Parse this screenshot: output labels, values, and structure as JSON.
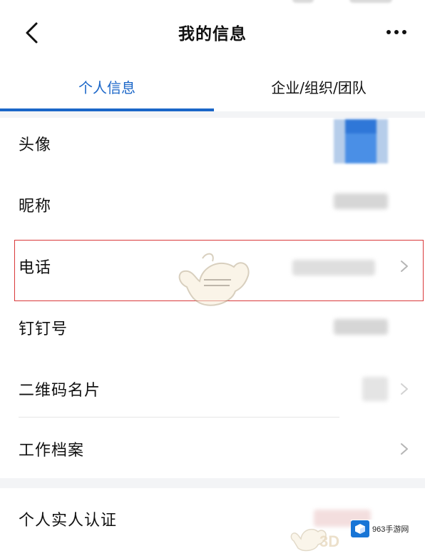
{
  "header": {
    "title": "我的信息"
  },
  "tabs": [
    {
      "label": "个人信息",
      "active": true
    },
    {
      "label": "企业/组织/团队",
      "active": false
    }
  ],
  "rows": [
    {
      "label": "头像",
      "value_visible": false
    },
    {
      "label": "昵称",
      "value_visible": false
    },
    {
      "label": "电话",
      "value_visible": false,
      "highlighted": true
    },
    {
      "label": "钉钉号",
      "value_visible": false
    },
    {
      "label": "二维码名片",
      "value_visible": false
    },
    {
      "label": "工作档案",
      "value_visible": false
    },
    {
      "label": "个人实人认证",
      "value_visible": false
    }
  ],
  "watermark": {
    "brand": "963手游网",
    "tag": "3D"
  },
  "colors": {
    "accent": "#1a66c8",
    "highlight_border": "#d9383a",
    "separator": "#f3f4f6"
  },
  "icons": {
    "back": "chevron-left-icon",
    "more": "more-dots-icon",
    "row_arrow": "chevron-right-icon"
  }
}
